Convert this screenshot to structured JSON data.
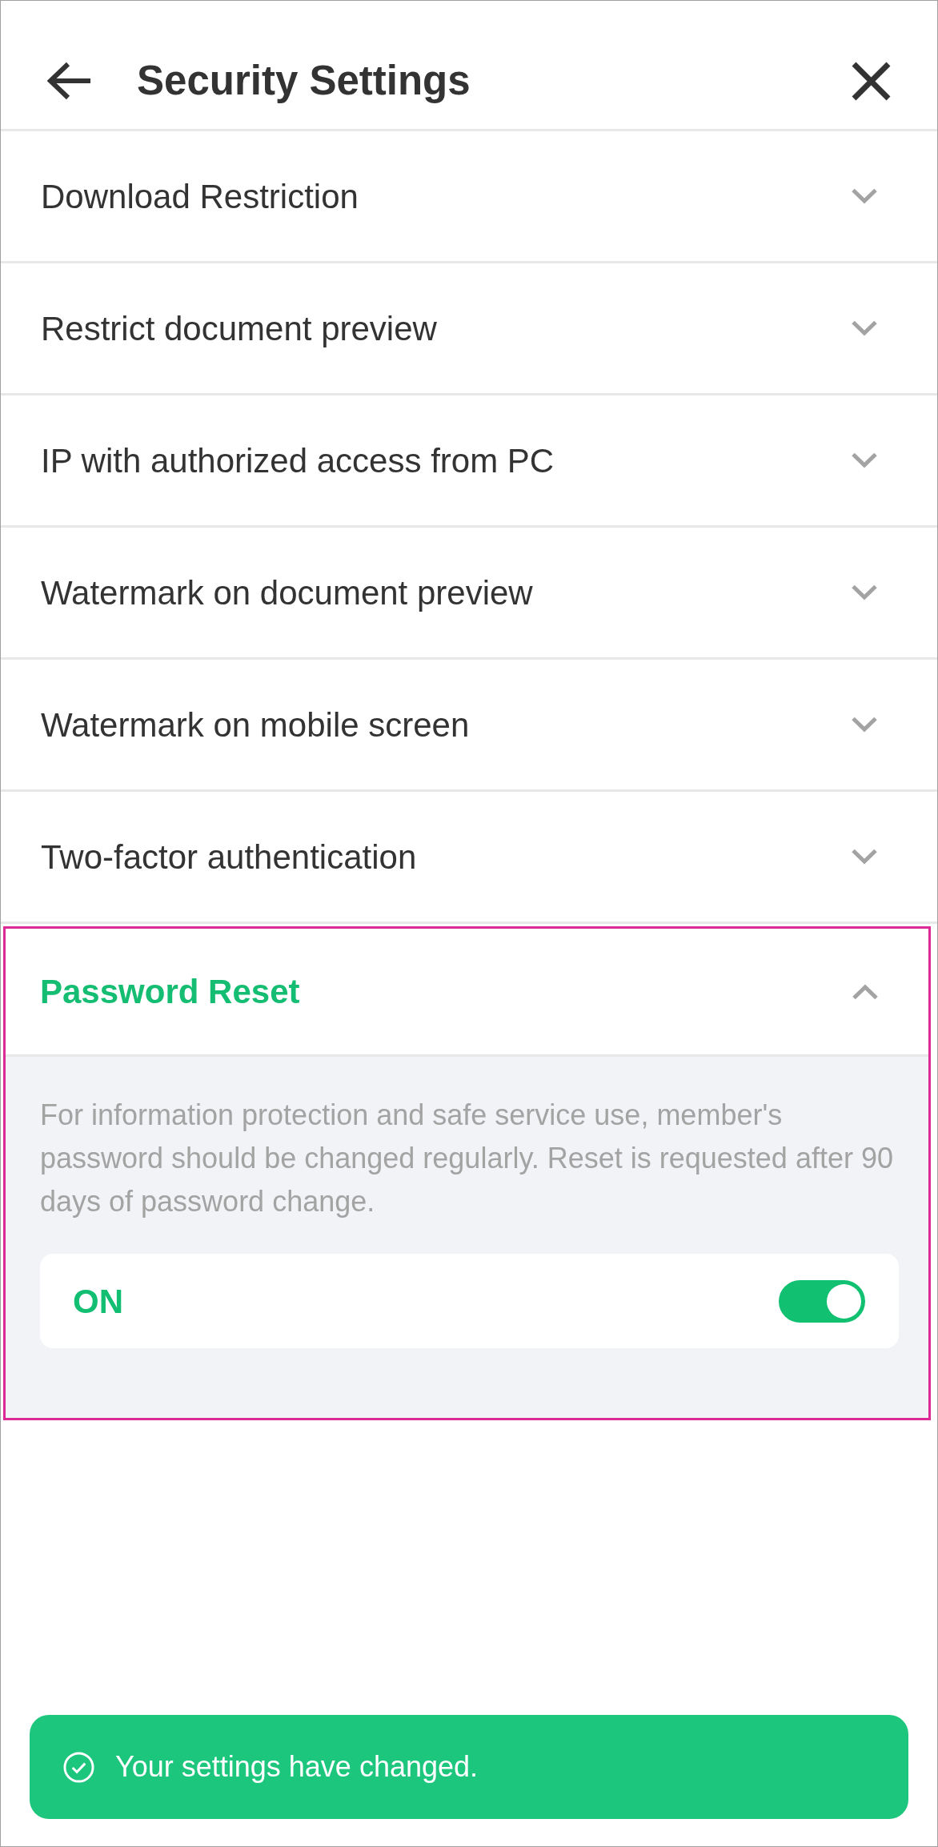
{
  "header": {
    "title": "Security Settings"
  },
  "settings": [
    {
      "label": "Download Restriction",
      "expanded": false,
      "highlighted": false
    },
    {
      "label": "Restrict document preview",
      "expanded": false,
      "highlighted": false
    },
    {
      "label": "IP with authorized access from PC",
      "expanded": false,
      "highlighted": false
    },
    {
      "label": "Watermark on document preview",
      "expanded": false,
      "highlighted": false
    },
    {
      "label": "Watermark on mobile screen",
      "expanded": false,
      "highlighted": false
    },
    {
      "label": "Two-factor authentication",
      "expanded": false,
      "highlighted": false
    },
    {
      "label": "Password Reset",
      "expanded": true,
      "highlighted": true,
      "description": "For information protection and safe service use, member's password should be changed regularly. Reset is requested after 90 days of password change.",
      "toggle": {
        "label": "ON",
        "on": true
      }
    }
  ],
  "toast": {
    "message": "Your settings have changed."
  }
}
